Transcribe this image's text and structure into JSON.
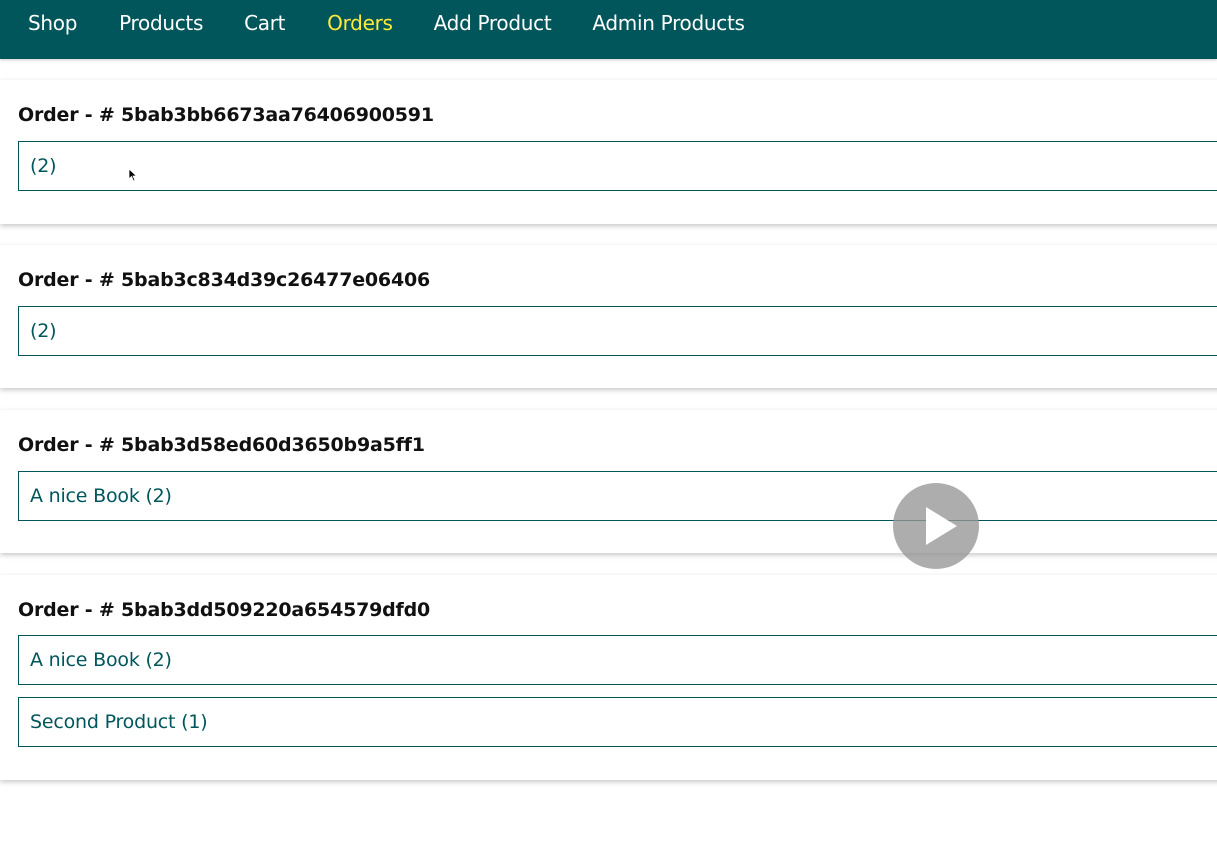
{
  "nav": {
    "items": [
      {
        "label": "Shop",
        "active": false
      },
      {
        "label": "Products",
        "active": false
      },
      {
        "label": "Cart",
        "active": false
      },
      {
        "label": "Orders",
        "active": true
      },
      {
        "label": "Add Product",
        "active": false
      },
      {
        "label": "Admin Products",
        "active": false
      }
    ]
  },
  "orders": [
    {
      "title": "Order - # 5bab3bb6673aa76406900591",
      "items": [
        "(2)"
      ]
    },
    {
      "title": "Order - # 5bab3c834d39c26477e06406",
      "items": [
        "(2)"
      ]
    },
    {
      "title": "Order - # 5bab3d58ed60d3650b9a5ff1",
      "items": [
        "A nice Book (2)"
      ]
    },
    {
      "title": "Order - # 5bab3dd509220a654579dfd0",
      "items": [
        "A nice Book (2)",
        "Second Product (1)"
      ]
    }
  ],
  "colors": {
    "nav_background": "#00565a",
    "nav_text": "#ffffff",
    "nav_active": "#ffeb3b",
    "item_border": "#00565a",
    "item_text": "#00565a"
  },
  "overlay": {
    "icon": "play-icon"
  }
}
